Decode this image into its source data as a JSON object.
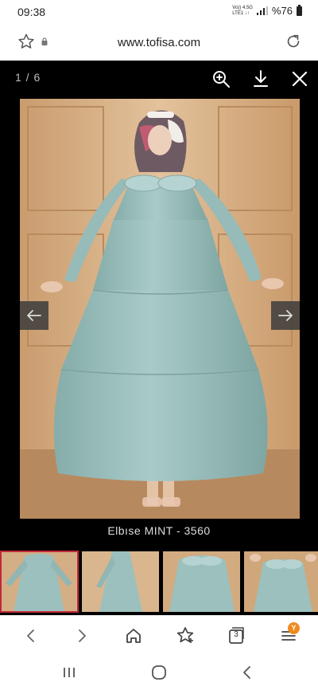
{
  "status_bar": {
    "time": "09:38",
    "network_top": "Vo)) 4.5G",
    "network_bottom": "LTE1 ↓↑",
    "battery": "%76"
  },
  "browser": {
    "url": "www.tofisa.com"
  },
  "gallery": {
    "counter": "1 / 6",
    "caption": "Elbıse MINT - 3560",
    "dress_color": "#9fc3c0",
    "background_color": "#d9b58c"
  },
  "thumbnails": [
    {
      "name": "thumb-1",
      "active": true
    },
    {
      "name": "thumb-2",
      "active": false
    },
    {
      "name": "thumb-3",
      "active": false
    },
    {
      "name": "thumb-4",
      "active": false
    }
  ],
  "toolbar": {
    "tab_count": "3",
    "menu_badge": "Y"
  },
  "colors": {
    "active_thumb_border": "#c0293a",
    "badge": "#f08a1c"
  }
}
